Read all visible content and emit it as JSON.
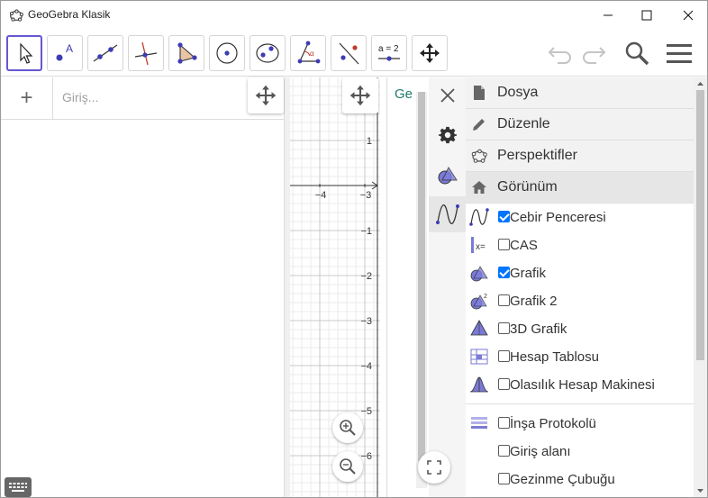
{
  "window": {
    "title": "GeoGebra Klasik"
  },
  "algebra": {
    "input_placeholder": "Giriş..."
  },
  "graphics": {
    "y_tick_labels": [
      "1",
      "−1",
      "−2",
      "−3",
      "−4",
      "−5",
      "−6"
    ],
    "x_tick_labels": [
      "−4",
      "−3"
    ]
  },
  "third_panel": {
    "header_text": "Ge"
  },
  "menu": {
    "headers": [
      "Dosya",
      "Düzenle",
      "Perspektifler",
      "Görünüm"
    ],
    "view_items": [
      {
        "label": "Cebir Penceresi",
        "checked": true,
        "icon": "algebra-view-icon"
      },
      {
        "label": "CAS",
        "checked": false,
        "icon": "cas-view-icon"
      },
      {
        "label": "Grafik",
        "checked": true,
        "icon": "graphics-view-icon"
      },
      {
        "label": "Grafik 2",
        "checked": false,
        "icon": "graphics2-view-icon"
      },
      {
        "label": "3D Grafik",
        "checked": false,
        "icon": "3d-graphics-view-icon"
      },
      {
        "label": "Hesap Tablosu",
        "checked": false,
        "icon": "spreadsheet-view-icon"
      },
      {
        "label": "Olasılık Hesap Makinesi",
        "checked": false,
        "icon": "probability-calculator-icon"
      },
      {
        "label": "İnşa Protokolü",
        "checked": false,
        "icon": "construction-protocol-icon"
      },
      {
        "label": "Giriş alanı",
        "checked": false,
        "icon": ""
      },
      {
        "label": "Gezinme Çubuğu",
        "checked": false,
        "icon": ""
      }
    ]
  },
  "toolbar": {
    "tools": [
      "move-tool",
      "point-tool",
      "line-tool",
      "perpendicular-line-tool",
      "polygon-tool",
      "circle-center-point-tool",
      "ellipse-tool",
      "angle-tool",
      "reflect-tool",
      "slider-tool",
      "move-graphics-view-tool"
    ],
    "slider_label": "a = 2"
  },
  "colors": {
    "accent": "#6557d2",
    "checkbox": "#0075ff",
    "tool_fill": "#7a7ad6"
  }
}
